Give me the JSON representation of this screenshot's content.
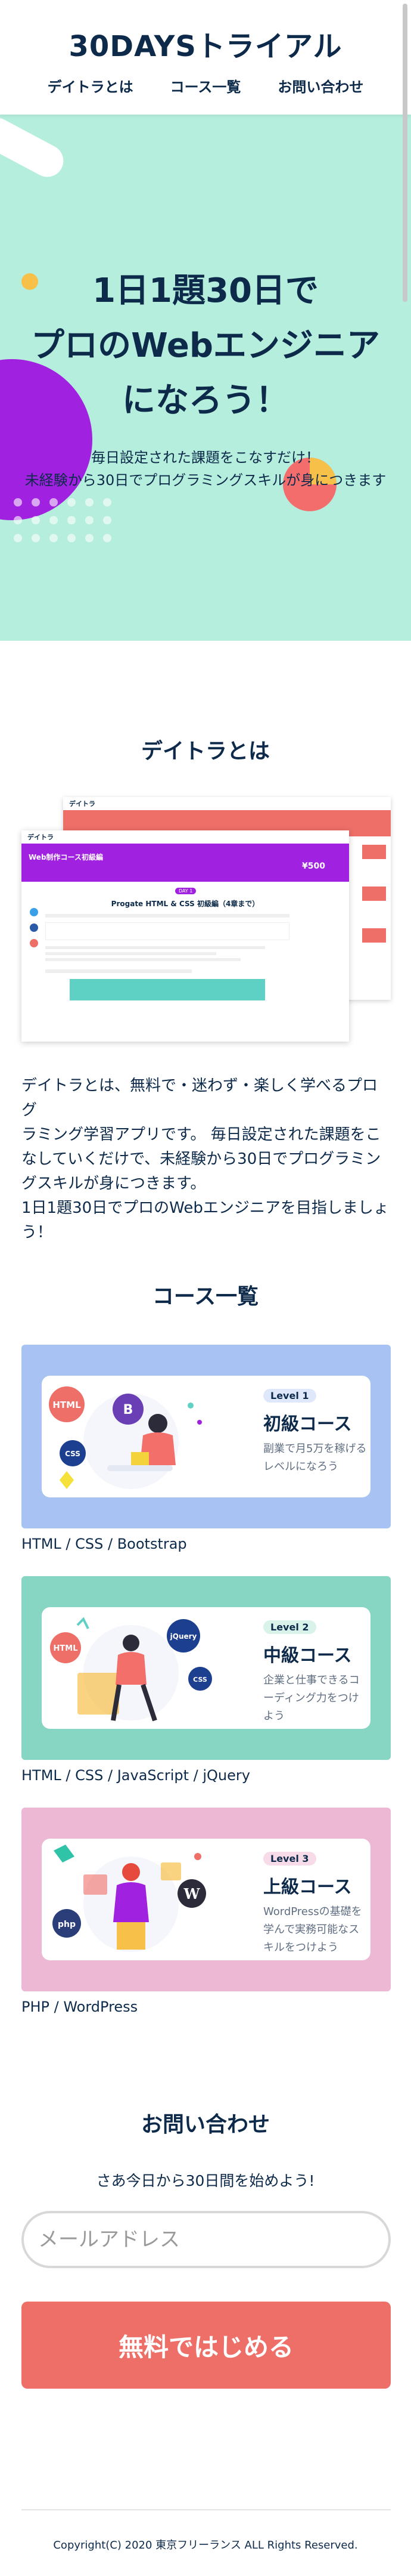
{
  "header": {
    "logo": "30DAYSトライアル",
    "nav": [
      "デイトラとは",
      "コース一覧",
      "お問い合わせ"
    ]
  },
  "hero": {
    "title_lines": [
      "1日1題30日で",
      "プロのWebエンジニア",
      "になろう！"
    ],
    "sub_lines": [
      "毎日設定された課題をこなすだけ！",
      "未経験から30日でプログラミングスキルが身につきます"
    ]
  },
  "about": {
    "heading": "デイトラとは",
    "mock": {
      "brand": "デイトラ",
      "banner": "Web制作コース初級編",
      "article_title": "Progate HTML & CSS 初級編（4章まで）",
      "price": "¥500",
      "day_badge": "DAY 1"
    },
    "text_lines": [
      "デイトラとは、無料で・迷わず・楽しく学べるプログ",
      "ラミング学習アプリです。 毎日設定された課題をこ",
      "なしていくだけで、未経験から30日でプログラミン",
      "グスキルが身につきます。",
      "1日1題30日でプロのWebエンジニアを目指しましょ",
      "う！"
    ]
  },
  "courses": {
    "heading": "コース一覧",
    "items": [
      {
        "level": "Level 1",
        "name": "初級コース",
        "desc": "副業で月5万を稼げるレベルになろう",
        "tags": "HTML / CSS / Bootstrap",
        "badges": [
          "HTML",
          "B",
          "CSS"
        ]
      },
      {
        "level": "Level 2",
        "name": "中級コース",
        "desc": "企業と仕事できるコーディング力をつけよう",
        "tags": "HTML / CSS / JavaScript / jQuery",
        "badges": [
          "HTML",
          "jQuery",
          "CSS"
        ]
      },
      {
        "level": "Level 3",
        "name": "上級コース",
        "desc": "WordPressの基礎を学んで実務可能なスキルをつけよう",
        "tags": "PHP / WordPress",
        "badges": [
          "php",
          "W"
        ]
      }
    ]
  },
  "contact": {
    "heading": "お問い合わせ",
    "sub": "さあ今日から30日間を始めよう!",
    "email_placeholder": "メールアドレス",
    "cta": "無料ではじめる"
  },
  "footer": {
    "copyright": "Copyright(C) 2020 東京フリーランス ALL Rights Reserved."
  },
  "colors": {
    "hero_bg": "#b5eedd",
    "card1_bg": "#a8c3f3",
    "card2_bg": "#86d6c3",
    "card3_bg": "#ecb8d4",
    "cta": "#ee6e68",
    "navy": "#0d2a4a"
  }
}
